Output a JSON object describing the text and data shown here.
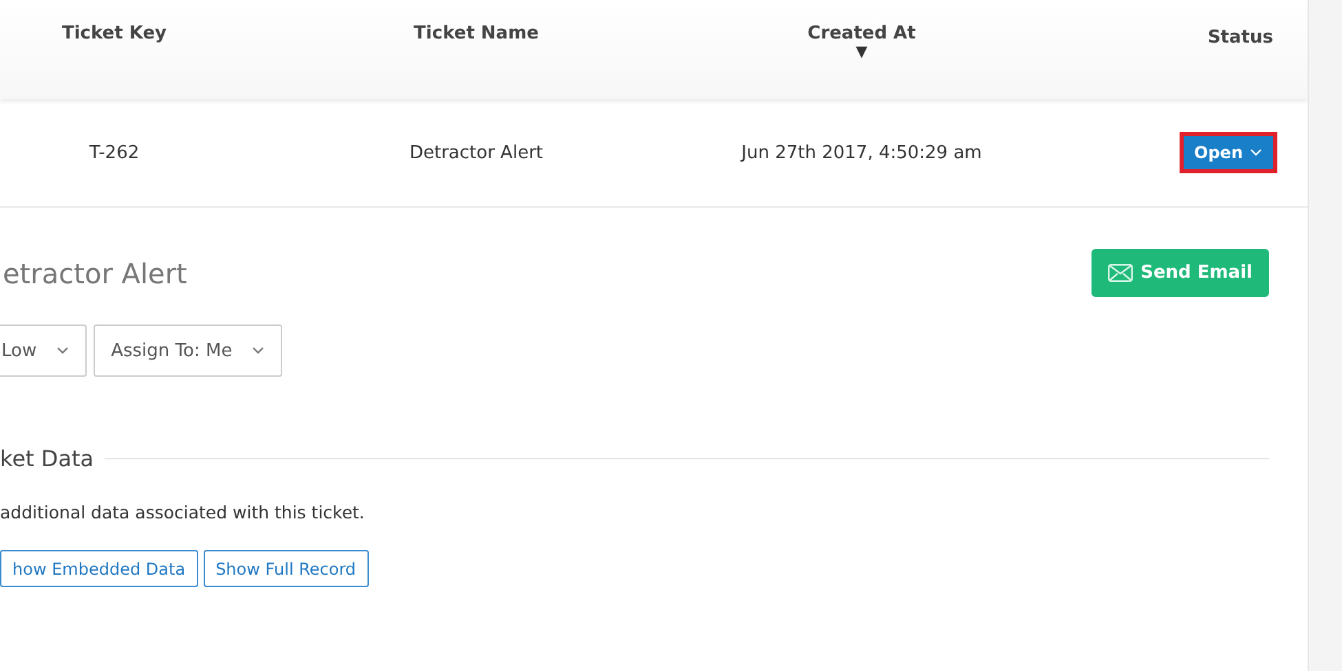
{
  "table": {
    "columns": [
      {
        "label": "Ticket Key"
      },
      {
        "label": "Ticket Name"
      },
      {
        "label": "Created At",
        "sort_indicator": "▼"
      },
      {
        "label": "Status"
      }
    ],
    "rows": [
      {
        "key": "T-262",
        "name": "Detractor Alert",
        "created_at": "Jun 27th 2017, 4:50:29 am",
        "status": {
          "label": "Open",
          "highlighted": true
        }
      }
    ]
  },
  "detail": {
    "title": "etractor Alert",
    "send_email": "Send Email",
    "dropdowns": [
      {
        "label": "Low"
      },
      {
        "label": "Assign To: Me"
      }
    ],
    "section": {
      "heading": "ket Data",
      "text": "additional data associated with this ticket.",
      "buttons": [
        "how Embedded Data",
        "Show Full Record"
      ]
    }
  }
}
